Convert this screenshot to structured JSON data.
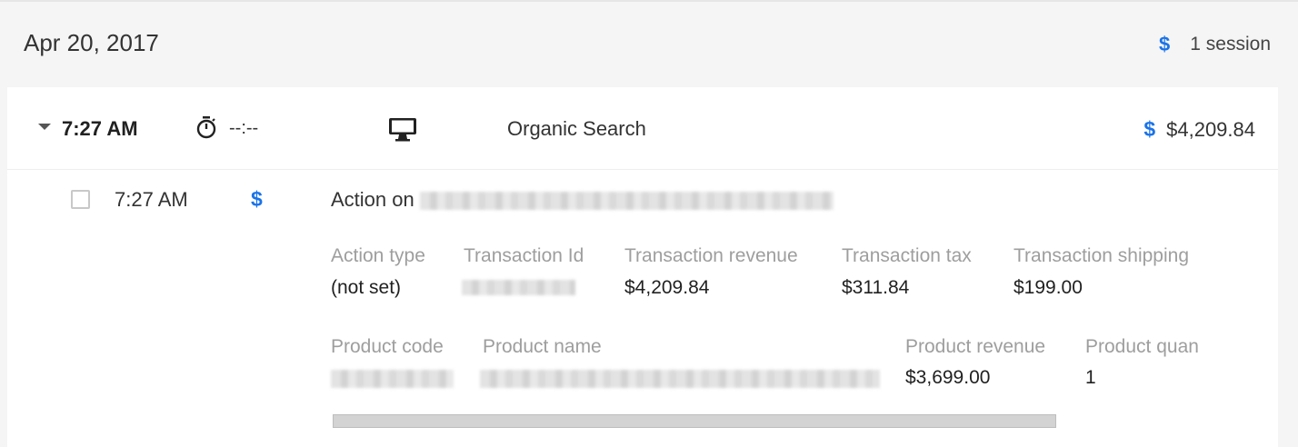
{
  "header": {
    "date": "Apr 20, 2017",
    "sessions_label": "1 session",
    "dollar_symbol": "$"
  },
  "session": {
    "time": "7:27 AM",
    "duration": "--:--",
    "channel": "Organic Search",
    "revenue": "$4,209.84",
    "icons": [
      "caret-down-icon",
      "stopwatch-icon",
      "desktop-icon",
      "dollar-icon"
    ]
  },
  "hit": {
    "time": "7:27 AM",
    "action_prefix": "Action on",
    "transaction": {
      "labels": [
        "Action type",
        "Transaction Id",
        "Transaction revenue",
        "Transaction tax",
        "Transaction shipping"
      ],
      "values": [
        "(not set)",
        "",
        "$4,209.84",
        "$311.84",
        "$199.00"
      ]
    },
    "product": {
      "labels": [
        "Product code",
        "Product name",
        "Product revenue",
        "Product quan"
      ],
      "values": [
        "",
        "",
        "$3,699.00",
        "1"
      ]
    }
  },
  "colors": {
    "accent": "#1a73e8",
    "label": "#9e9e9e",
    "background": "#f5f5f5"
  }
}
